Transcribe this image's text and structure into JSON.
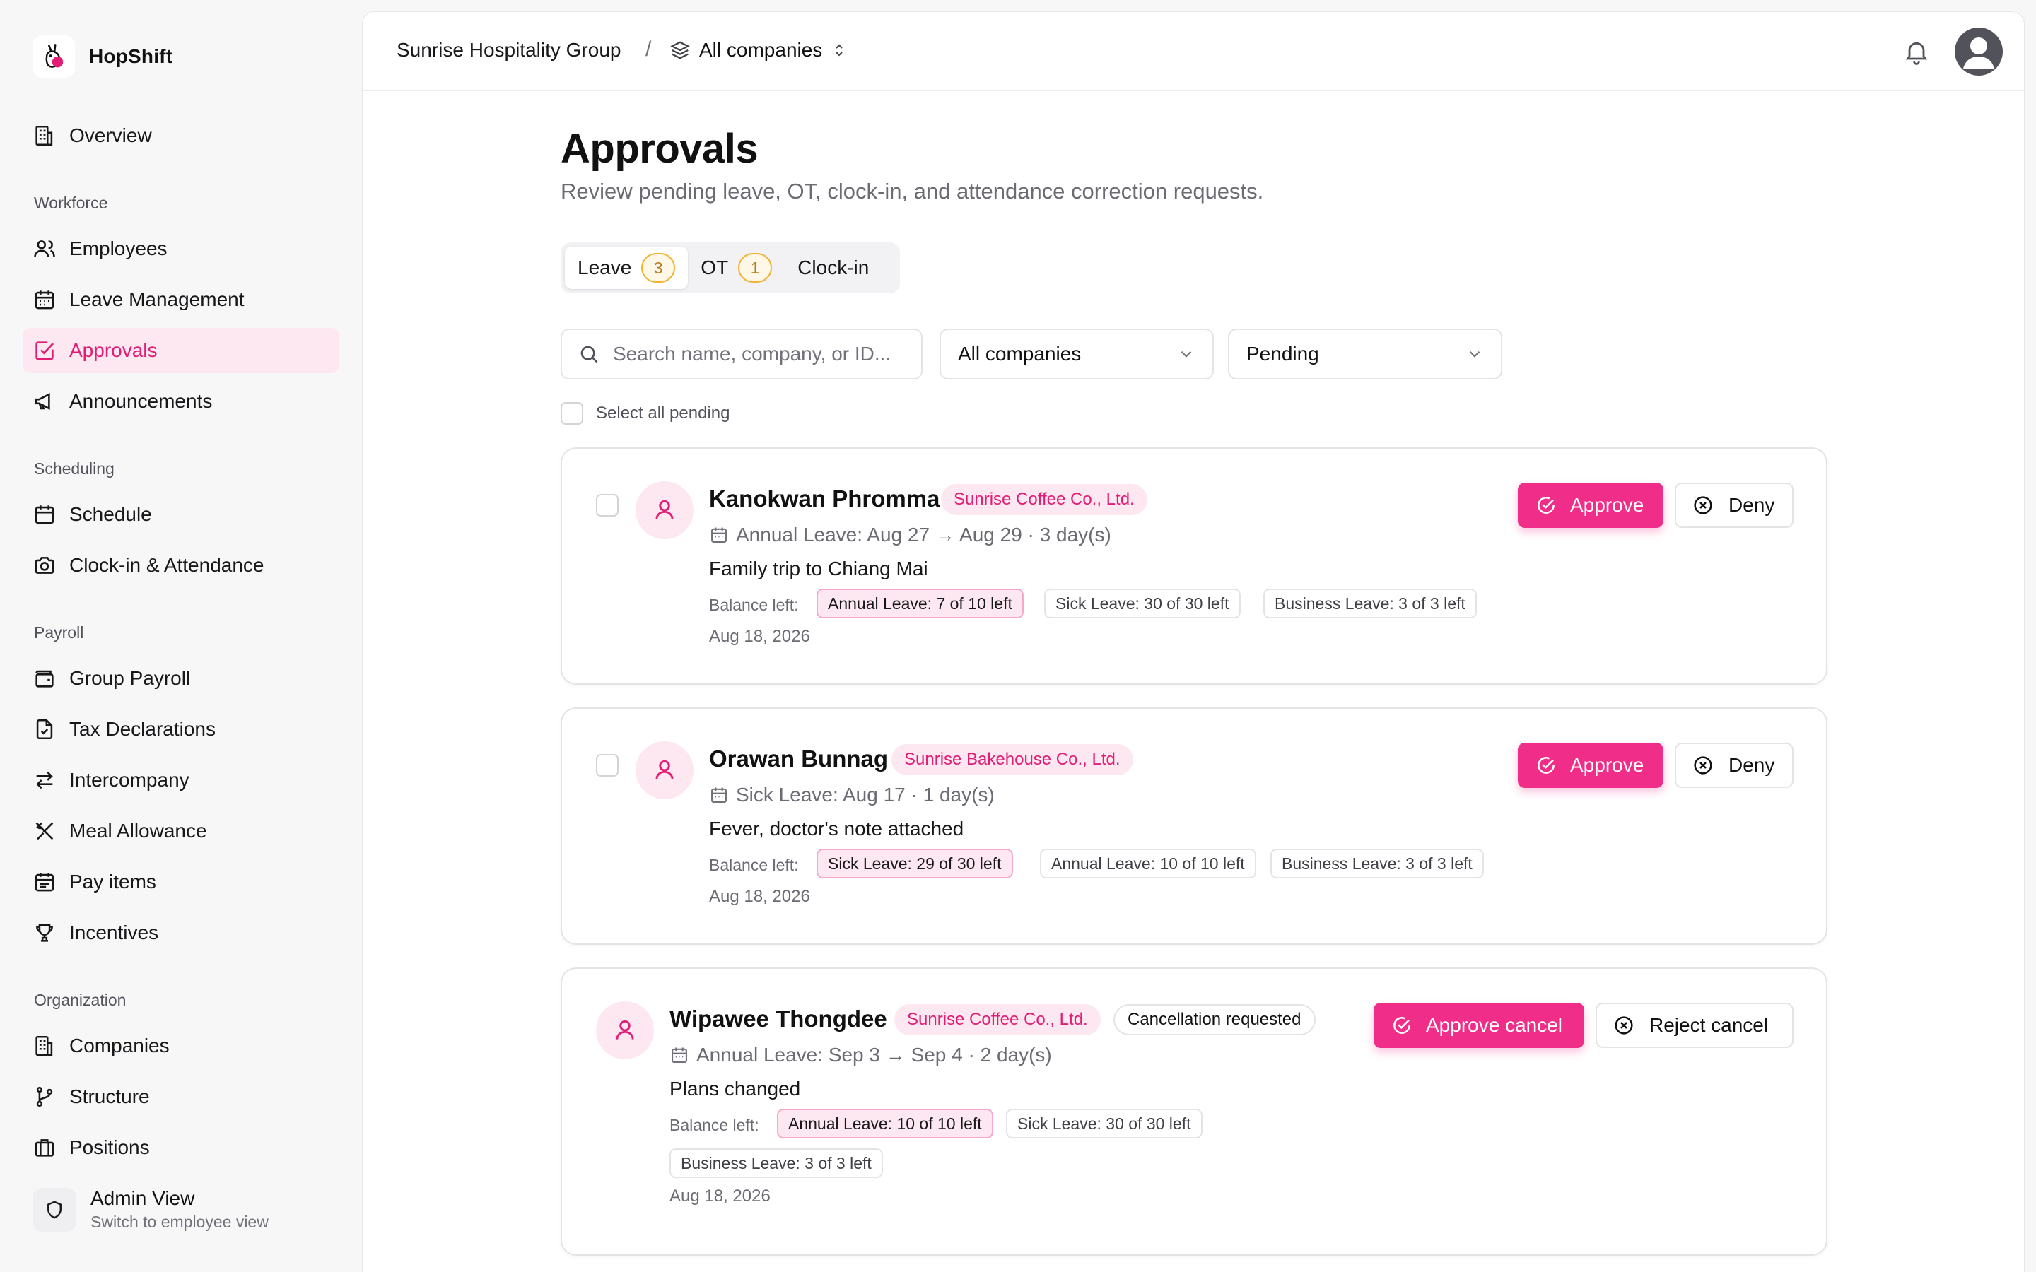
{
  "app": {
    "name": "HopShift"
  },
  "sidebar": {
    "overview": "Overview",
    "sections": {
      "workforce": "Workforce",
      "scheduling": "Scheduling",
      "payroll": "Payroll",
      "organization": "Organization"
    },
    "items": {
      "employees": "Employees",
      "leave": "Leave Management",
      "approvals": "Approvals",
      "announcements": "Announcements",
      "schedule": "Schedule",
      "clockin": "Clock-in & Attendance",
      "group_payroll": "Group Payroll",
      "tax": "Tax Declarations",
      "intercompany": "Intercompany",
      "meal": "Meal Allowance",
      "pay_items": "Pay items",
      "incentives": "Incentives",
      "companies": "Companies",
      "structure": "Structure",
      "positions": "Positions"
    },
    "active": "approvals",
    "admin": {
      "title": "Admin View",
      "subtitle": "Switch to employee view"
    }
  },
  "topbar": {
    "org": "Sunrise Hospitality Group",
    "separator": "/",
    "company_switcher": "All companies"
  },
  "page": {
    "title": "Approvals",
    "subtitle": "Review pending leave, OT, clock-in, and attendance correction requests."
  },
  "tabs": [
    {
      "label": "Leave",
      "count": "3",
      "active": true
    },
    {
      "label": "OT",
      "count": "1",
      "active": false
    },
    {
      "label": "Clock-in",
      "count": "",
      "active": false
    }
  ],
  "filters": {
    "search_placeholder": "Search name, company, or ID...",
    "company": "All companies",
    "status": "Pending",
    "select_all": "Select all pending"
  },
  "balance_label": "Balance left:",
  "requests": [
    {
      "name": "Kanokwan Phromma",
      "company": "Sunrise Coffee Co., Ltd.",
      "leave": "Annual Leave: Aug 27 → Aug 29 · 3 day(s)",
      "reason": "Family trip to Chiang Mai",
      "balances": [
        "Annual Leave: 7 of 10 left",
        "Sick Leave: 30 of 30 left",
        "Business Leave: 3 of 3 left"
      ],
      "date": "Aug 18, 2026",
      "approve": "Approve",
      "deny": "Deny"
    },
    {
      "name": "Orawan Bunnag",
      "company": "Sunrise Bakehouse Co., Ltd.",
      "leave": "Sick Leave: Aug 17 · 1 day(s)",
      "reason": "Fever, doctor's note attached",
      "balances": [
        "Sick Leave: 29 of 30 left",
        "Annual Leave: 10 of 10 left",
        "Business Leave: 3 of 3 left"
      ],
      "date": "Aug 18, 2026",
      "approve": "Approve",
      "deny": "Deny"
    },
    {
      "name": "Wipawee Thongdee",
      "company": "Sunrise Coffee Co., Ltd.",
      "status": "Cancellation requested",
      "leave": "Annual Leave: Sep 3 → Sep 4 · 2 day(s)",
      "reason": "Plans changed",
      "balances": [
        "Annual Leave: 10 of 10 left",
        "Sick Leave: 30 of 30 left",
        "Business Leave: 3 of 3 left"
      ],
      "date": "Aug 18, 2026",
      "approve": "Approve cancel",
      "deny": "Reject cancel"
    }
  ],
  "colors": {
    "accent": "#f02d88",
    "accent_soft": "#fde7f1",
    "badge_amber": "#f3b233"
  }
}
